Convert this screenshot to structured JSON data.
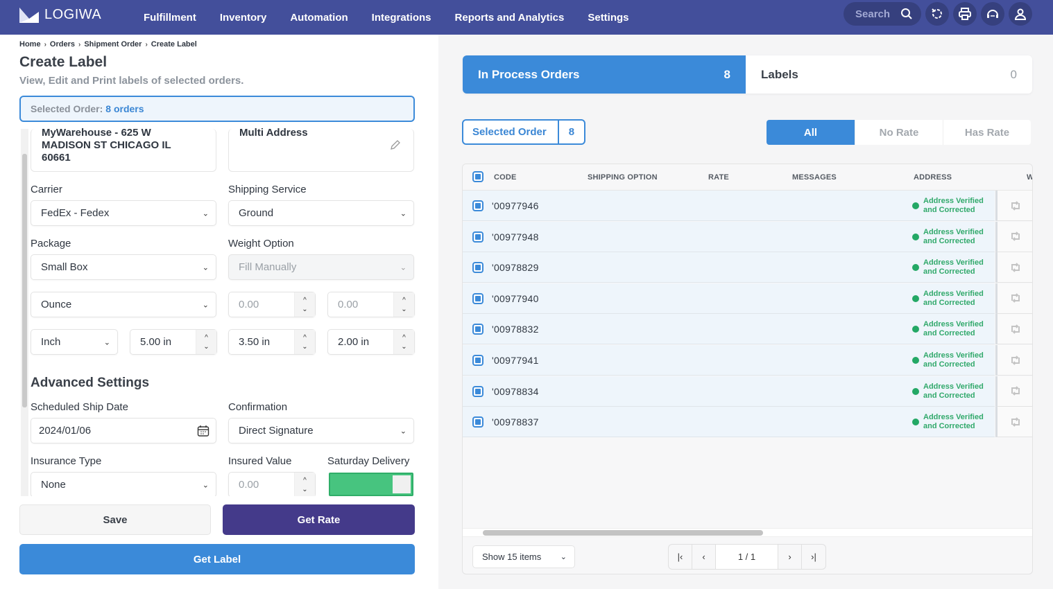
{
  "app": {
    "brand": "LOGIWA"
  },
  "nav": {
    "items": [
      "Fulfillment",
      "Inventory",
      "Automation",
      "Integrations",
      "Reports and Analytics",
      "Settings"
    ],
    "search_placeholder": "Search"
  },
  "breadcrumb": [
    "Home",
    "Orders",
    "Shipment Order",
    "Create Label"
  ],
  "page": {
    "title": "Create Label",
    "subtitle": "View, Edit and Print labels of selected orders."
  },
  "selected_order": {
    "label": "Selected Order:",
    "value": "8 orders"
  },
  "form": {
    "from_address": "MyWarehouse - 625 W MADISON ST CHICAGO IL 60661",
    "to_address": "Multi Address",
    "carrier": {
      "label": "Carrier",
      "value": "FedEx - Fedex"
    },
    "shipping_service": {
      "label": "Shipping Service",
      "value": "Ground"
    },
    "package": {
      "label": "Package",
      "value": "Small Box"
    },
    "weight_option": {
      "label": "Weight Option",
      "value": "Fill Manually"
    },
    "weight_unit": "Ounce",
    "weight_1": "0.00",
    "weight_2": "0.00",
    "dim_unit": "Inch",
    "length": "5.00 in",
    "width": "3.50 in",
    "height": "2.00 in",
    "advanced_title": "Advanced Settings",
    "ship_date": {
      "label": "Scheduled Ship Date",
      "value": "2024/01/06"
    },
    "confirmation": {
      "label": "Confirmation",
      "value": "Direct Signature"
    },
    "insurance_type": {
      "label": "Insurance Type",
      "value": "None"
    },
    "insured_value": {
      "label": "Insured Value",
      "value": "0.00"
    },
    "saturday_delivery": {
      "label": "Saturday Delivery",
      "enabled": true
    }
  },
  "buttons": {
    "save": "Save",
    "get_rate": "Get Rate",
    "get_label": "Get Label"
  },
  "right": {
    "tabs": [
      {
        "label": "In Process Orders",
        "count": "8",
        "active": true
      },
      {
        "label": "Labels",
        "count": "0",
        "active": false
      }
    ],
    "selected_order": {
      "label": "Selected Order",
      "count": "8"
    },
    "filters": [
      "All",
      "No Rate",
      "Has Rate"
    ],
    "columns": [
      "CODE",
      "SHIPPING OPTION",
      "RATE",
      "MESSAGES",
      "ADDRESS",
      "W"
    ],
    "rows": [
      {
        "code": "'00977946",
        "address_status": "Address Verified and Corrected"
      },
      {
        "code": "'00977948",
        "address_status": "Address Verified and Corrected"
      },
      {
        "code": "'00978829",
        "address_status": "Address Verified and Corrected"
      },
      {
        "code": "'00977940",
        "address_status": "Address Verified and Corrected"
      },
      {
        "code": "'00978832",
        "address_status": "Address Verified and Corrected"
      },
      {
        "code": "'00977941",
        "address_status": "Address Verified and Corrected"
      },
      {
        "code": "'00978834",
        "address_status": "Address Verified and Corrected"
      },
      {
        "code": "'00978837",
        "address_status": "Address Verified and Corrected"
      }
    ],
    "show_items": "Show 15 items",
    "page_indicator": "1 / 1"
  },
  "colors": {
    "nav": "#434f9b",
    "accent": "#3b8ad9",
    "primary_dark": "#443a8a",
    "success": "#31a96b"
  }
}
